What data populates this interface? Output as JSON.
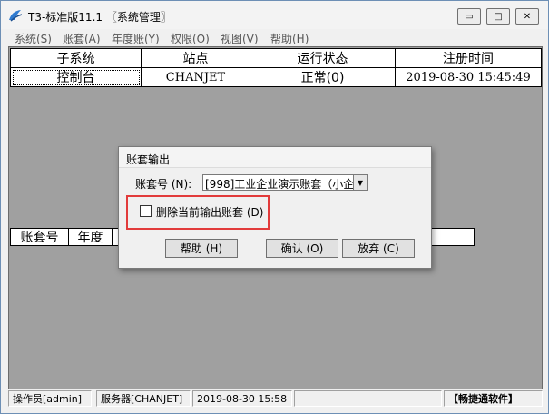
{
  "window": {
    "title": "T3-标准版11.1 〖系统管理〗",
    "minimize_glyph": "▭",
    "maximize_glyph": "□",
    "close_glyph": "✕"
  },
  "menu": {
    "items": [
      "系统(S)",
      "账套(A)",
      "年度账(Y)",
      "权限(O)",
      "视图(V)",
      "帮助(H)"
    ]
  },
  "top_grid": {
    "headers": [
      "子系统",
      "站点",
      "运行状态",
      "注册时间"
    ],
    "rows": [
      [
        "控制台",
        "CHANJET",
        "正常(0)",
        "2019-08-30 15:45:49"
      ]
    ]
  },
  "lower_grid": {
    "headers": [
      "账套号",
      "年度"
    ]
  },
  "dialog": {
    "title": "账套输出",
    "account_label": "账套号 (N):",
    "account_value": "[998]工业企业演示账套（小企",
    "dropdown_arrow": "▼",
    "delete_checkbox_label": "删除当前输出账套 (D)",
    "delete_checked": false,
    "help_label": "帮助 (H)",
    "ok_label": "确认 (O)",
    "cancel_label": "放弃 (C)",
    "highlight_color": "#e23b3b"
  },
  "status": {
    "operator": "操作员[admin]",
    "server": "服务器[CHANJET]",
    "date": "2019-08-30 15:58",
    "brand": "【畅捷通软件】"
  }
}
